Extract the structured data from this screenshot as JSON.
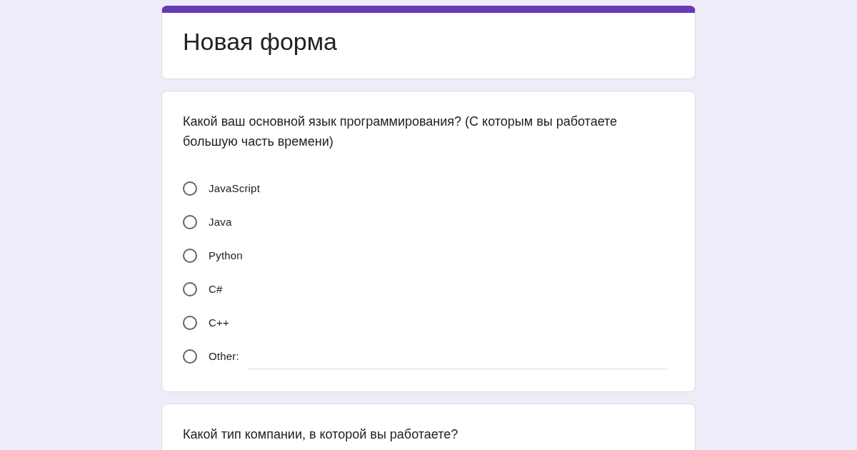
{
  "form": {
    "title": "Новая форма"
  },
  "questions": [
    {
      "text": "Какой ваш основной язык программирования? (С которым вы работаете большую часть времени)",
      "options": [
        {
          "label": "JavaScript",
          "kind": "plain",
          "selected": false
        },
        {
          "label": "Java",
          "kind": "plain",
          "selected": false
        },
        {
          "label": "Python",
          "kind": "plain",
          "selected": false
        },
        {
          "label": "C#",
          "kind": "plain",
          "selected": false
        },
        {
          "label": "C++",
          "kind": "plain",
          "selected": false
        },
        {
          "label": "Other:",
          "kind": "other",
          "selected": false
        }
      ]
    },
    {
      "text": "Какой тип компании, в которой вы работаете?"
    }
  ]
}
